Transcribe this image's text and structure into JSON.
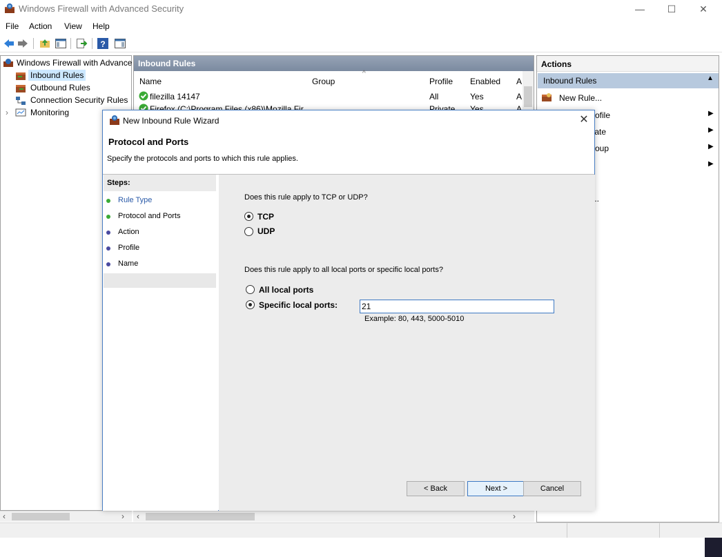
{
  "window": {
    "title": "Windows Firewall with Advanced Security",
    "minimize": "—",
    "maximize": "☐",
    "close": "✕"
  },
  "menu": [
    "File",
    "Action",
    "View",
    "Help"
  ],
  "tree": {
    "root": "Windows Firewall with Advance",
    "items": [
      "Inbound Rules",
      "Outbound Rules",
      "Connection Security Rules",
      "Monitoring"
    ]
  },
  "center": {
    "header": "Inbound Rules",
    "columns": [
      "Name",
      "Group",
      "Profile",
      "Enabled",
      "A"
    ],
    "rows": [
      {
        "name": "filezilla 14147",
        "group": "",
        "profile": "All",
        "enabled": "Yes",
        "a": "A"
      },
      {
        "name": "Firefox (C:\\Program Files (x86)\\Mozilla Fir...",
        "group": "",
        "profile": "Private",
        "enabled": "Yes",
        "a": "A"
      }
    ]
  },
  "actions": {
    "header": "Actions",
    "section": "Inbound Rules",
    "items": [
      "New Rule...",
      "rofile",
      "tate",
      "roup",
      "",
      "..."
    ]
  },
  "dialog": {
    "title": "New Inbound Rule Wizard",
    "heading": "Protocol and Ports",
    "description": "Specify the protocols and ports to which this rule applies.",
    "steps_header": "Steps:",
    "steps": [
      "Rule Type",
      "Protocol and Ports",
      "Action",
      "Profile",
      "Name"
    ],
    "question1": "Does this rule apply to TCP or UDP?",
    "tcp_label": "TCP",
    "udp_label": "UDP",
    "question2": "Does this rule apply to all local ports or specific local ports?",
    "all_ports_label": "All local ports",
    "specific_ports_label": "Specific local ports:",
    "ports_value": "21",
    "example": "Example: 80, 443, 5000-5010",
    "back": "< Back",
    "next": "Next >",
    "cancel": "Cancel",
    "close": "✕"
  },
  "colors": {
    "accent": "#3c78c3",
    "selected_tree": "#cce8ff",
    "actions_section": "#b7c9de",
    "step_done": "#3aaa35",
    "step_pending": "#4a4aa0"
  }
}
